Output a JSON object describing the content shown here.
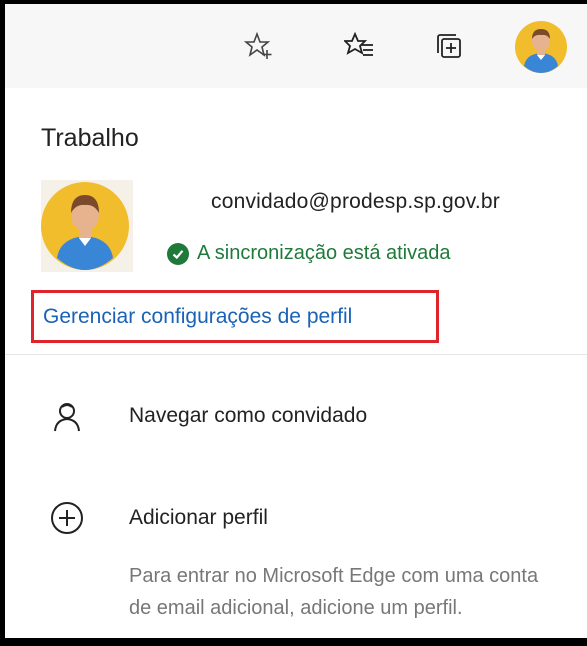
{
  "toolbar": {
    "icons": [
      "add-favorite-icon",
      "favorites-icon",
      "collections-icon",
      "profile-avatar-icon"
    ]
  },
  "profile_panel": {
    "title": "Trabalho",
    "email": "convidado@prodesp.sp.gov.br",
    "sync_status": "A sincronização está ativada",
    "manage_link": "Gerenciar configurações de perfil"
  },
  "menu": {
    "guest_label": "Navegar como convidado",
    "add_profile_label": "Adicionar perfil",
    "add_profile_description": "Para entrar no Microsoft Edge com uma conta de email adicional, adicione um perfil."
  },
  "colors": {
    "link": "#1a62b6",
    "sync_green": "#1f7a3a",
    "highlight_red": "#e0242b",
    "avatar_yellow": "#f2bd2c",
    "avatar_shirt": "#3a86d6"
  }
}
